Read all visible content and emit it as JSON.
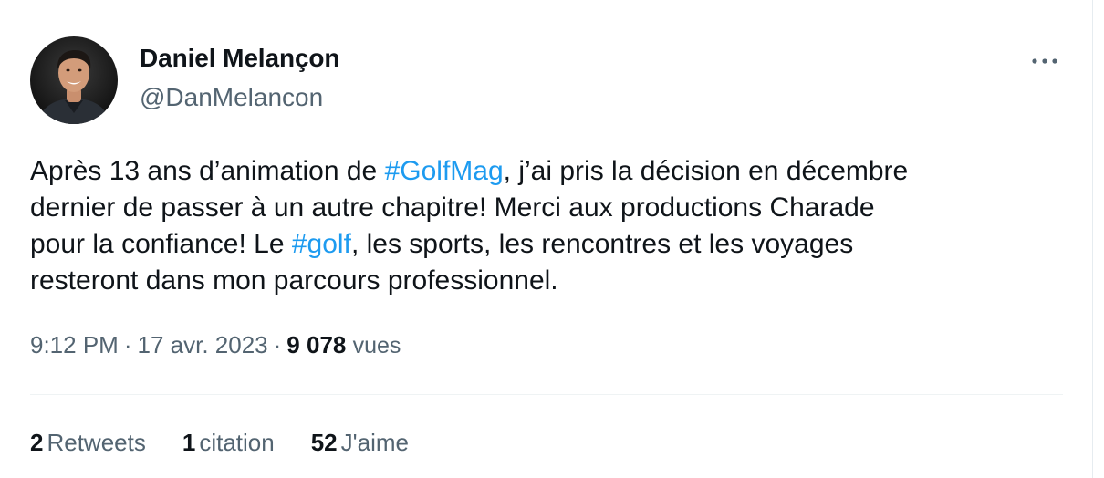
{
  "author": {
    "name": "Daniel Melançon",
    "handle": "@DanMelancon"
  },
  "tweet": {
    "lines": [
      {
        "before": "Après 13 ans d’animation de ",
        "tag": "#GolfMag",
        "after": ", j’ai pris la décision en décembre"
      },
      {
        "before": "dernier de passer à un autre chapitre! Merci aux productions Charade",
        "tag": "",
        "after": ""
      },
      {
        "before": "pour la confiance! Le ",
        "tag": "#golf",
        "after": ", les sports, les rencontres et les voyages"
      },
      {
        "before": "resteront dans mon parcours professionnel.",
        "tag": "",
        "after": ""
      }
    ]
  },
  "meta": {
    "time": "9:12 PM",
    "separator": "·",
    "date": "17 avr. 2023",
    "views_count": "9 078",
    "views_label": "vues"
  },
  "stats": {
    "retweets_count": "2",
    "retweets_label": "Retweets",
    "quotes_count": "1",
    "quotes_label": "citation",
    "likes_count": "52",
    "likes_label": "J'aime"
  },
  "icons": {
    "more": "more-horizontal-icon"
  },
  "colors": {
    "text": "#0f1419",
    "secondary": "#536471",
    "link": "#1d9bf0",
    "divider": "#eff3f4"
  }
}
